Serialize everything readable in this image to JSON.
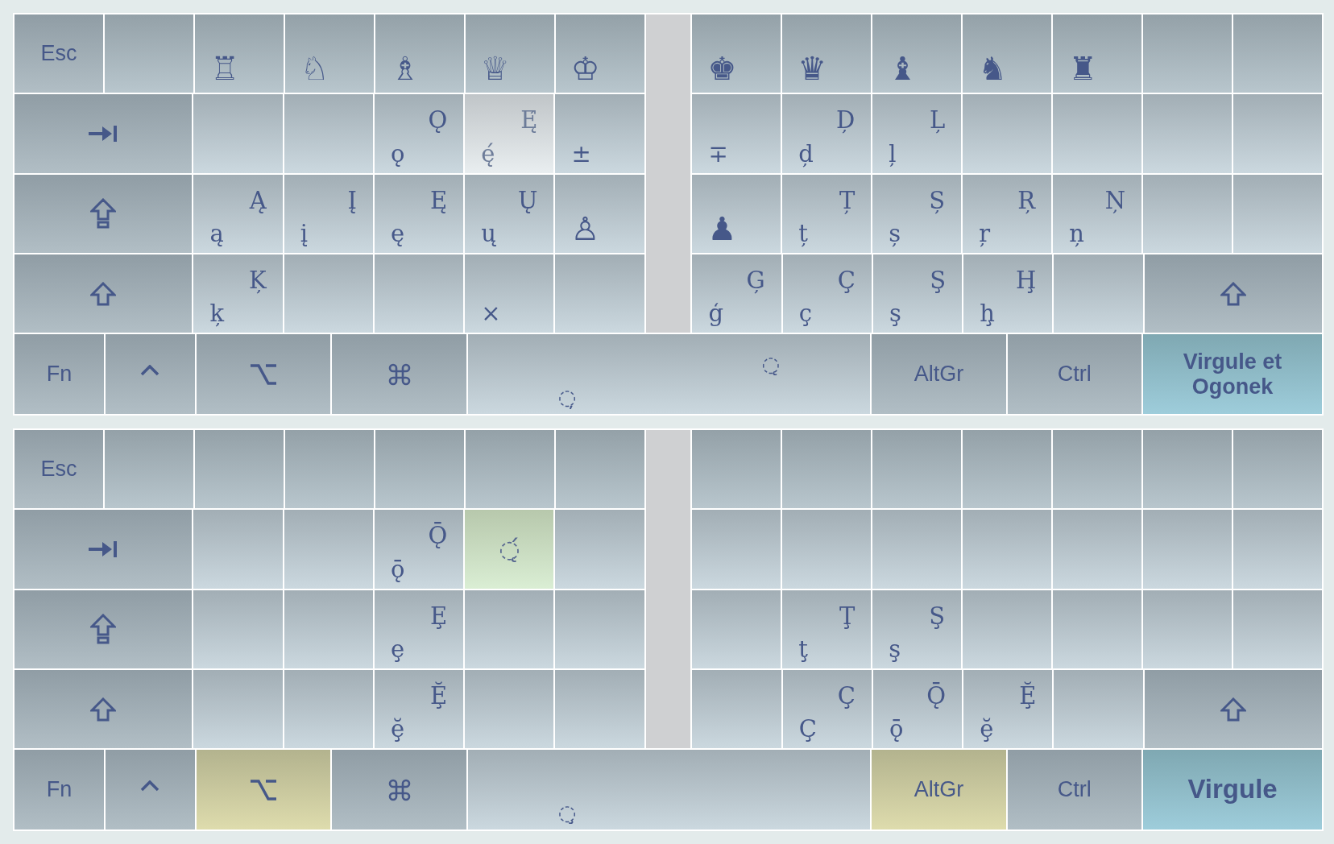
{
  "keyboards": [
    {
      "rows": [
        {
          "left": [
            {
              "kind": "esc",
              "label": "Esc",
              "pressed": false
            },
            {
              "kind": "blank",
              "pressed": false
            },
            {
              "kind": "chess",
              "char": "♖",
              "pressed": false,
              "highlighted": false
            },
            {
              "kind": "chess",
              "char": "♘",
              "pressed": false,
              "highlighted": false
            },
            {
              "kind": "chess",
              "char": "♗",
              "pressed": false,
              "highlighted": false
            },
            {
              "kind": "chess",
              "char": "♕",
              "pressed": false,
              "highlighted": false
            },
            {
              "kind": "chess",
              "char": "♔",
              "pressed": false,
              "highlighted": false
            }
          ],
          "right": [
            {
              "kind": "chess",
              "char": "♚",
              "pressed": false,
              "highlighted": false
            },
            {
              "kind": "chess",
              "char": "♛",
              "pressed": false,
              "highlighted": false
            },
            {
              "kind": "chess",
              "char": "♝",
              "pressed": false,
              "highlighted": false
            },
            {
              "kind": "chess",
              "char": "♞",
              "pressed": false,
              "highlighted": false
            },
            {
              "kind": "chess",
              "char": "♜",
              "pressed": false,
              "highlighted": false
            },
            {
              "kind": "blank",
              "pressed": false
            },
            {
              "kind": "blank",
              "pressed": false
            }
          ]
        },
        {
          "left": [
            {
              "kind": "tab",
              "pressed": false
            },
            {
              "kind": "blank",
              "pressed": false
            },
            {
              "kind": "blank",
              "pressed": false
            },
            {
              "kind": "char",
              "lower": "ǫ",
              "upper": "Ǫ",
              "pressed": false,
              "highlighted": false
            },
            {
              "kind": "char",
              "lower": "ę́",
              "upper": "Ę́",
              "pressed": false,
              "highlighted": true
            },
            {
              "kind": "char",
              "lower": "±",
              "pressed": false,
              "highlighted": false
            }
          ],
          "right": [
            {
              "kind": "char",
              "lower": "∓",
              "pressed": false,
              "highlighted": false
            },
            {
              "kind": "char",
              "lower": "d̦",
              "upper": "D̦",
              "pressed": false,
              "highlighted": false
            },
            {
              "kind": "char",
              "lower": "ļ",
              "upper": "Ļ",
              "pressed": false,
              "highlighted": false
            },
            {
              "kind": "blank",
              "pressed": false
            },
            {
              "kind": "blank",
              "pressed": false
            },
            {
              "kind": "blank",
              "pressed": false
            },
            {
              "kind": "blank",
              "pressed": false
            }
          ]
        },
        {
          "left": [
            {
              "kind": "capslock",
              "pressed": false
            },
            {
              "kind": "char",
              "lower": "ą",
              "upper": "Ą",
              "pressed": false,
              "highlighted": false
            },
            {
              "kind": "char",
              "lower": "į",
              "upper": "Į",
              "pressed": false,
              "highlighted": false
            },
            {
              "kind": "char",
              "lower": "ę",
              "upper": "Ę",
              "pressed": false,
              "highlighted": false
            },
            {
              "kind": "char",
              "lower": "ų",
              "upper": "Ų",
              "pressed": false,
              "highlighted": false
            },
            {
              "kind": "chess",
              "char": "♙",
              "pressed": false,
              "highlighted": false
            }
          ],
          "right": [
            {
              "kind": "chess",
              "char": "♟",
              "pressed": false,
              "highlighted": false
            },
            {
              "kind": "char",
              "lower": "ț",
              "upper": "Ț",
              "pressed": false,
              "highlighted": false
            },
            {
              "kind": "char",
              "lower": "ș",
              "upper": "Ș",
              "pressed": false,
              "highlighted": false
            },
            {
              "kind": "char",
              "lower": "ŗ",
              "upper": "Ŗ",
              "pressed": false,
              "highlighted": false
            },
            {
              "kind": "char",
              "lower": "ņ",
              "upper": "Ņ",
              "pressed": false,
              "highlighted": false
            },
            {
              "kind": "blank",
              "pressed": false
            },
            {
              "kind": "blank",
              "pressed": false
            }
          ]
        },
        {
          "left": [
            {
              "kind": "shift",
              "pressed": false
            },
            {
              "kind": "char",
              "lower": "ķ",
              "upper": "Ķ",
              "pressed": false,
              "highlighted": false
            },
            {
              "kind": "blank",
              "pressed": false
            },
            {
              "kind": "blank",
              "pressed": false
            },
            {
              "kind": "char",
              "lower": "×",
              "pressed": false,
              "highlighted": false
            },
            {
              "kind": "blank",
              "pressed": false
            }
          ],
          "right": [
            {
              "kind": "char",
              "lower": "ģ",
              "upper": "Ģ",
              "pressed": false,
              "highlighted": false
            },
            {
              "kind": "char",
              "lower": "ç",
              "upper": "Ç",
              "pressed": false,
              "highlighted": false
            },
            {
              "kind": "char",
              "lower": "ş",
              "upper": "Ş",
              "pressed": false,
              "highlighted": false
            },
            {
              "kind": "char",
              "lower": "ḩ",
              "upper": "Ḩ",
              "pressed": false,
              "highlighted": false
            },
            {
              "kind": "blank",
              "pressed": false
            },
            {
              "kind": "shift",
              "pressed": false
            }
          ]
        }
      ],
      "bottom_row": [
        {
          "kind": "fn",
          "label": "Fn",
          "pressed": false
        },
        {
          "kind": "control",
          "pressed": false
        },
        {
          "kind": "option",
          "pressed": false
        },
        {
          "kind": "command",
          "pressed": false
        },
        {
          "kind": "space",
          "lower": "◌̦",
          "upper": "◌̨",
          "pressed": false
        },
        {
          "kind": "altgr",
          "label": "AltGr",
          "pressed": false
        },
        {
          "kind": "ctrl",
          "label": "Ctrl",
          "pressed": false
        },
        {
          "kind": "mode",
          "label": "Virgule et Ogonek",
          "selected": true
        }
      ]
    },
    {
      "rows": [
        {
          "left": [
            {
              "kind": "esc",
              "label": "Esc",
              "pressed": false
            },
            {
              "kind": "blank",
              "pressed": false
            },
            {
              "kind": "blank",
              "pressed": false
            },
            {
              "kind": "blank",
              "pressed": false
            },
            {
              "kind": "blank",
              "pressed": false
            },
            {
              "kind": "blank",
              "pressed": false
            },
            {
              "kind": "blank",
              "pressed": false
            }
          ],
          "right": [
            {
              "kind": "blank",
              "pressed": false
            },
            {
              "kind": "blank",
              "pressed": false
            },
            {
              "kind": "blank",
              "pressed": false
            },
            {
              "kind": "blank",
              "pressed": false
            },
            {
              "kind": "blank",
              "pressed": false
            },
            {
              "kind": "blank",
              "pressed": false
            },
            {
              "kind": "blank",
              "pressed": false
            }
          ]
        },
        {
          "left": [
            {
              "kind": "tab",
              "pressed": false
            },
            {
              "kind": "blank",
              "pressed": false
            },
            {
              "kind": "blank",
              "pressed": false
            },
            {
              "kind": "char",
              "lower": "ǭ",
              "upper": "Ǭ",
              "pressed": false,
              "highlighted": false
            },
            {
              "kind": "mark",
              "char": "◌̨́",
              "pressed": false,
              "highlighted": true
            },
            {
              "kind": "blank",
              "pressed": false
            }
          ],
          "right": [
            {
              "kind": "blank",
              "pressed": false
            },
            {
              "kind": "blank",
              "pressed": false
            },
            {
              "kind": "blank",
              "pressed": false
            },
            {
              "kind": "blank",
              "pressed": false
            },
            {
              "kind": "blank",
              "pressed": false
            },
            {
              "kind": "blank",
              "pressed": false
            },
            {
              "kind": "blank",
              "pressed": false
            }
          ]
        },
        {
          "left": [
            {
              "kind": "capslock",
              "pressed": false
            },
            {
              "kind": "blank",
              "pressed": false
            },
            {
              "kind": "blank",
              "pressed": false
            },
            {
              "kind": "char",
              "lower": "ȩ",
              "upper": "Ȩ",
              "pressed": false,
              "highlighted": false
            },
            {
              "kind": "blank",
              "pressed": false
            },
            {
              "kind": "blank",
              "pressed": false
            }
          ],
          "right": [
            {
              "kind": "blank",
              "pressed": false
            },
            {
              "kind": "char",
              "lower": "ţ",
              "upper": "Ţ",
              "pressed": false,
              "highlighted": false
            },
            {
              "kind": "char",
              "lower": "ş",
              "upper": "Ş",
              "pressed": false,
              "highlighted": false
            },
            {
              "kind": "blank",
              "pressed": false
            },
            {
              "kind": "blank",
              "pressed": false
            },
            {
              "kind": "blank",
              "pressed": false
            },
            {
              "kind": "blank",
              "pressed": false
            }
          ]
        },
        {
          "left": [
            {
              "kind": "shift",
              "pressed": false
            },
            {
              "kind": "blank",
              "pressed": false
            },
            {
              "kind": "blank",
              "pressed": false
            },
            {
              "kind": "char",
              "lower": "ḝ",
              "upper": "Ḝ",
              "pressed": false,
              "highlighted": false
            },
            {
              "kind": "blank",
              "pressed": false
            },
            {
              "kind": "blank",
              "pressed": false
            }
          ],
          "right": [
            {
              "kind": "blank",
              "pressed": false
            },
            {
              "kind": "char",
              "lower": "Ç",
              "upper": "Ç",
              "pressed": false,
              "highlighted": false
            },
            {
              "kind": "char",
              "lower": "ǭ",
              "upper": "Ǭ",
              "pressed": false,
              "highlighted": false
            },
            {
              "kind": "char",
              "lower": "ḝ",
              "upper": "Ḝ",
              "pressed": false,
              "highlighted": false
            },
            {
              "kind": "blank",
              "pressed": false
            },
            {
              "kind": "shift",
              "pressed": false
            }
          ]
        }
      ],
      "bottom_row": [
        {
          "kind": "fn",
          "label": "Fn",
          "pressed": false
        },
        {
          "kind": "control",
          "pressed": false
        },
        {
          "kind": "option",
          "pressed": true
        },
        {
          "kind": "command",
          "pressed": false
        },
        {
          "kind": "space",
          "lower": "◌̧",
          "pressed": false
        },
        {
          "kind": "altgr",
          "label": "AltGr",
          "pressed": true
        },
        {
          "kind": "ctrl",
          "label": "Ctrl",
          "pressed": false
        },
        {
          "kind": "mode",
          "label": "Virgule",
          "selected": true
        }
      ]
    }
  ]
}
